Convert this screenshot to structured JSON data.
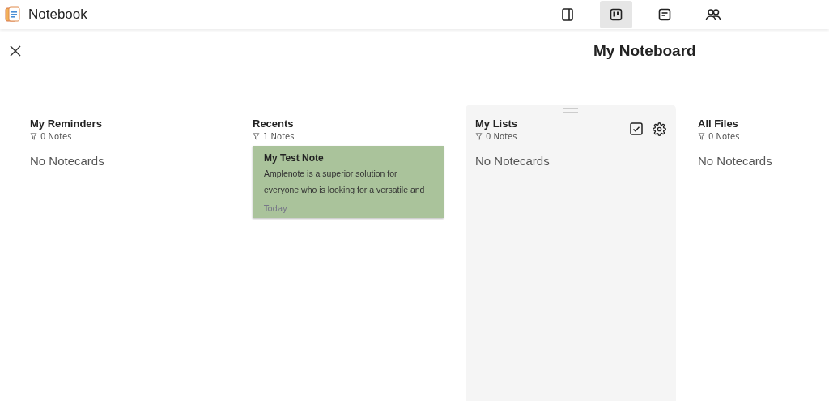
{
  "app": {
    "title": "Notebook"
  },
  "toolbar": [
    {
      "kind": "sidebar",
      "selected": false
    },
    {
      "kind": "board",
      "selected": true
    },
    {
      "kind": "note",
      "selected": false
    },
    {
      "kind": "people",
      "selected": false
    }
  ],
  "board": {
    "title": "My Noteboard"
  },
  "columns": [
    {
      "title": "My Reminders",
      "count": "0 Notes",
      "highlighted": false,
      "empty": "No Notecards"
    },
    {
      "title": "Recents",
      "count": "1 Notes",
      "highlighted": false,
      "cards": [
        {
          "title": "My Test Note",
          "body": "Amplenote is a superior solution for everyone who is looking for a versatile and",
          "date": "Today",
          "color": "#aac39b"
        }
      ]
    },
    {
      "title": "My Lists",
      "count": "0 Notes",
      "highlighted": true,
      "actions": true,
      "empty": "No Notecards"
    },
    {
      "title": "All Files",
      "count": "0 Notes",
      "highlighted": false,
      "empty": "No Notecards"
    }
  ]
}
